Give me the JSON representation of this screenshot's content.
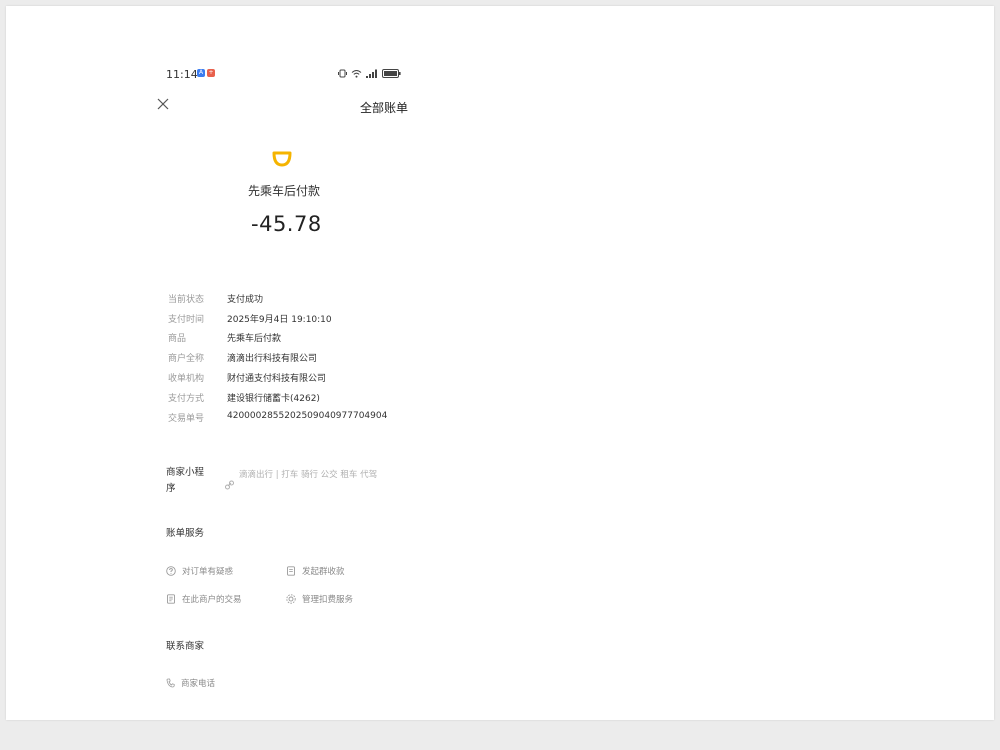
{
  "status_bar": {
    "time": "11:14",
    "badge1": "A",
    "badge2": "+"
  },
  "header": {
    "title": "全部账单"
  },
  "merchant": {
    "name": "先乘车后付款",
    "amount": "-45.78"
  },
  "details": [
    {
      "label": "当前状态",
      "value": "支付成功"
    },
    {
      "label": "支付时间",
      "value": "2025年9月4日 19:10:10"
    },
    {
      "label": "商品",
      "value": "先乘车后付款"
    },
    {
      "label": "商户全称",
      "value": "滴滴出行科技有限公司"
    },
    {
      "label": "收单机构",
      "value": "财付通支付科技有限公司"
    },
    {
      "label": "支付方式",
      "value": "建设银行储蓄卡(4262)"
    },
    {
      "label": "交易单号",
      "value": "4200002855202509040977704904"
    }
  ],
  "mini_program": {
    "label": "商家小程序",
    "link": "滴滴出行 | 打车 骑行 公交 租车 代驾"
  },
  "bill_service": {
    "title": "账单服务",
    "items": [
      {
        "label": "对订单有疑惑",
        "icon": "question-icon"
      },
      {
        "label": "发起群收款",
        "icon": "receipt-icon"
      },
      {
        "label": "在此商户的交易",
        "icon": "document-icon"
      },
      {
        "label": "管理扣费服务",
        "icon": "gear-icon"
      }
    ]
  },
  "contact": {
    "title": "联系商家",
    "phone_label": "商家电话"
  },
  "colors": {
    "logo": "#f5b400",
    "muted": "#9a9a9a"
  }
}
